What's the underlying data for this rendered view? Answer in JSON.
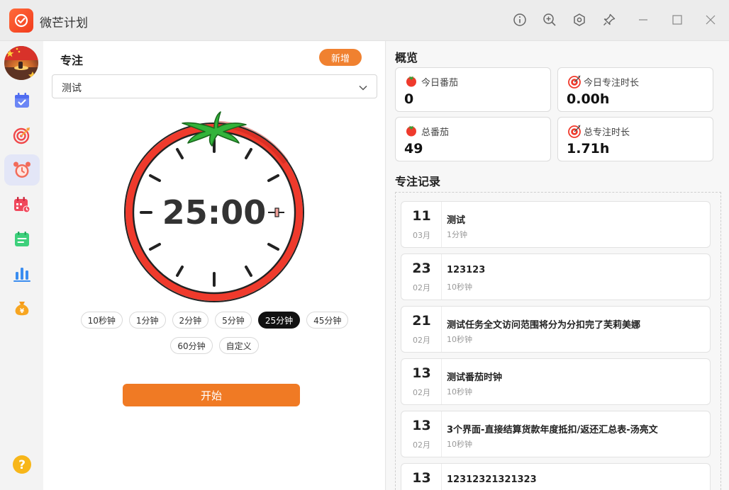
{
  "app": {
    "title": "微芒计划"
  },
  "titlebar": {
    "icons": [
      "info-icon",
      "zoom-icon",
      "settings-icon",
      "pin-icon",
      "minimize-icon",
      "maximize-icon",
      "close-icon"
    ]
  },
  "sidebar": {
    "items": [
      {
        "name": "calendar-check-icon",
        "color": "#5b7cf2"
      },
      {
        "name": "target-icon",
        "color": "#f04444"
      },
      {
        "name": "alarm-clock-icon",
        "color": "#f05a4a",
        "active": true
      },
      {
        "name": "calendar-schedule-icon",
        "color": "#f04a5a"
      },
      {
        "name": "notes-icon",
        "color": "#3ccf7a"
      },
      {
        "name": "stats-icon",
        "color": "#3a8df0"
      },
      {
        "name": "money-bag-icon",
        "color": "#f7a520"
      }
    ],
    "help_icon": "help-icon"
  },
  "focus": {
    "title": "专注",
    "add_label": "新增",
    "selected_task": "测试",
    "timer_text": "25:00",
    "durations": [
      "10秒钟",
      "1分钟",
      "2分钟",
      "5分钟",
      "25分钟",
      "45分钟",
      "60分钟",
      "自定义"
    ],
    "selected_duration": "25分钟",
    "start_label": "开始"
  },
  "overview": {
    "title": "概览",
    "stats": [
      {
        "label": "今日番茄",
        "value": "0",
        "icon": "tomato-icon"
      },
      {
        "label": "今日专注时长",
        "value": "0.00h",
        "icon": "target-icon"
      },
      {
        "label": "总番茄",
        "value": "49",
        "icon": "tomato-icon"
      },
      {
        "label": "总专注时长",
        "value": "1.71h",
        "icon": "target-icon"
      }
    ]
  },
  "records": {
    "title": "专注记录",
    "items": [
      {
        "day": "11",
        "month": "03月",
        "title": "测试",
        "duration": "1分钟"
      },
      {
        "day": "23",
        "month": "02月",
        "title": "123123",
        "duration": "10秒钟"
      },
      {
        "day": "21",
        "month": "02月",
        "title": "测试任务全文访问范围将分为分扣完了芙莉美娜",
        "duration": "10秒钟"
      },
      {
        "day": "13",
        "month": "02月",
        "title": "测试番茄时钟",
        "duration": "10秒钟"
      },
      {
        "day": "13",
        "month": "02月",
        "title": "3个界面-直接结算货款年度抵扣/返还汇总表-汤亮文",
        "duration": "10秒钟"
      },
      {
        "day": "13",
        "month": "",
        "title": "12312321321323",
        "duration": ""
      }
    ]
  },
  "colors": {
    "accent": "#f07a24",
    "tomato": "#ef3a2c",
    "active_chip": "#111111"
  }
}
